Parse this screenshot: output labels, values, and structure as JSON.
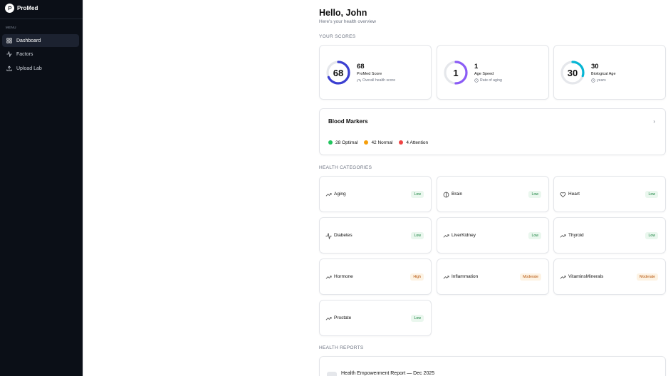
{
  "brand": {
    "name": "ProMed"
  },
  "sidebar": {
    "menu_label": "MENU",
    "items": [
      {
        "label": "Dashboard",
        "icon": "grid-icon",
        "active": true
      },
      {
        "label": "Factors",
        "icon": "activity-icon",
        "active": false
      },
      {
        "label": "Upload Lab",
        "icon": "upload-icon",
        "active": false
      }
    ]
  },
  "header": {
    "greeting": "Hello,  John",
    "subtitle": "Here's your health overview"
  },
  "scores": {
    "section_label": "YOUR SCORES",
    "items": [
      {
        "value": "68",
        "title": "68",
        "name": "ProMed Score",
        "desc": "Overall health score",
        "fraction": 0.68,
        "color": "#3b3fd1"
      },
      {
        "value": "1",
        "title": "1",
        "name": "Age Speed",
        "desc": "Rate of aging",
        "fraction": 0.5,
        "color": "#8b5cf6"
      },
      {
        "value": "30",
        "title": "30",
        "name": "Biological Age",
        "desc": "years",
        "fraction": 0.3,
        "color": "#06b6d4"
      }
    ]
  },
  "blood_markers": {
    "title": "Blood Markers",
    "legend": [
      {
        "label": "28 Optimal",
        "color": "#22c55e"
      },
      {
        "label": "42 Normal",
        "color": "#f59e0b"
      },
      {
        "label": "4 Attention",
        "color": "#ef4444"
      }
    ]
  },
  "categories": {
    "section_label": "HEALTH CATEGORIES",
    "items": [
      {
        "name": "Aging",
        "status": "Low",
        "icon": "trend-up-icon"
      },
      {
        "name": "Brain",
        "status": "Low",
        "icon": "brain-icon"
      },
      {
        "name": "Heart",
        "status": "Low",
        "icon": "heart-icon"
      },
      {
        "name": "Diabetes",
        "status": "Low",
        "icon": "activity-icon"
      },
      {
        "name": "LiverKidney",
        "status": "Low",
        "icon": "trend-up-icon"
      },
      {
        "name": "Thyroid",
        "status": "Low",
        "icon": "trend-up-icon"
      },
      {
        "name": "Hormone",
        "status": "High",
        "icon": "trend-up-icon"
      },
      {
        "name": "Inflammation",
        "status": "Moderate",
        "icon": "trend-up-icon"
      },
      {
        "name": "VitaminsMinerals",
        "status": "Moderate",
        "icon": "trend-up-icon"
      },
      {
        "name": "Prostate",
        "status": "Low",
        "icon": "trend-up-icon"
      }
    ]
  },
  "reports": {
    "section_label": "HEALTH REPORTS",
    "items": [
      {
        "title": "Health Empowerment Report — Dec 2025"
      }
    ]
  }
}
